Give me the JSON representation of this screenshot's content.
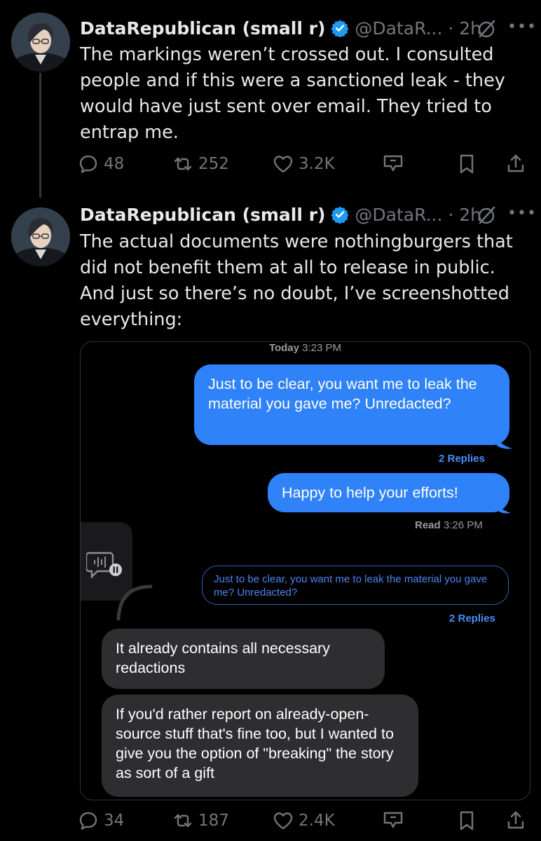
{
  "tweets": [
    {
      "author_name": "DataRepublican (small r)",
      "handle_time": "@DataR... · 2h",
      "text": "The markings weren’t crossed out. I consulted people and if this were a sanctioned leak - they would have just sent over email. They tried to entrap me.",
      "replies": "48",
      "reposts": "252",
      "likes": "3.2K"
    },
    {
      "author_name": "DataRepublican (small r)",
      "handle_time": "@DataR... · 2h",
      "text": "The actual documents were nothingburgers that did not benefit them at all to release in public. And just so there’s no doubt, I’ve screenshotted everything:",
      "replies": "34",
      "reposts": "187",
      "likes": "2.4K"
    }
  ],
  "chat": {
    "timestamp_day": "Today",
    "timestamp_time": "3:23 PM",
    "msg1": "Just to be clear, you want me to leak the material you gave me? Unredacted?",
    "msg1_replies": "2 Replies",
    "msg2": "Happy to help your efforts!",
    "read_label": "Read",
    "read_time": "3:26 PM",
    "quoted": "Just to be clear, you want me to leak the material you gave me? Unredacted?",
    "quoted_replies": "2 Replies",
    "reply1": "It already contains all necessary redactions",
    "reply2": "If you'd rather report on already-open-source stuff that's fine too, but I wanted to give you the option of \"breaking\" the story as sort of a gift"
  },
  "icons": {
    "verified": "verified-badge-icon",
    "grok": "grok-icon",
    "more": "more-icon",
    "reply": "reply-icon",
    "repost": "repost-icon",
    "like": "heart-icon",
    "grok_action": "grok-action-icon",
    "bookmark": "bookmark-icon",
    "share": "share-icon"
  },
  "colors": {
    "background": "#000000",
    "verified_blue": "#1d9bf0",
    "muted": "#71767b",
    "imessage_blue": "#2f82f7",
    "bubble_gray": "#2e2e30"
  }
}
